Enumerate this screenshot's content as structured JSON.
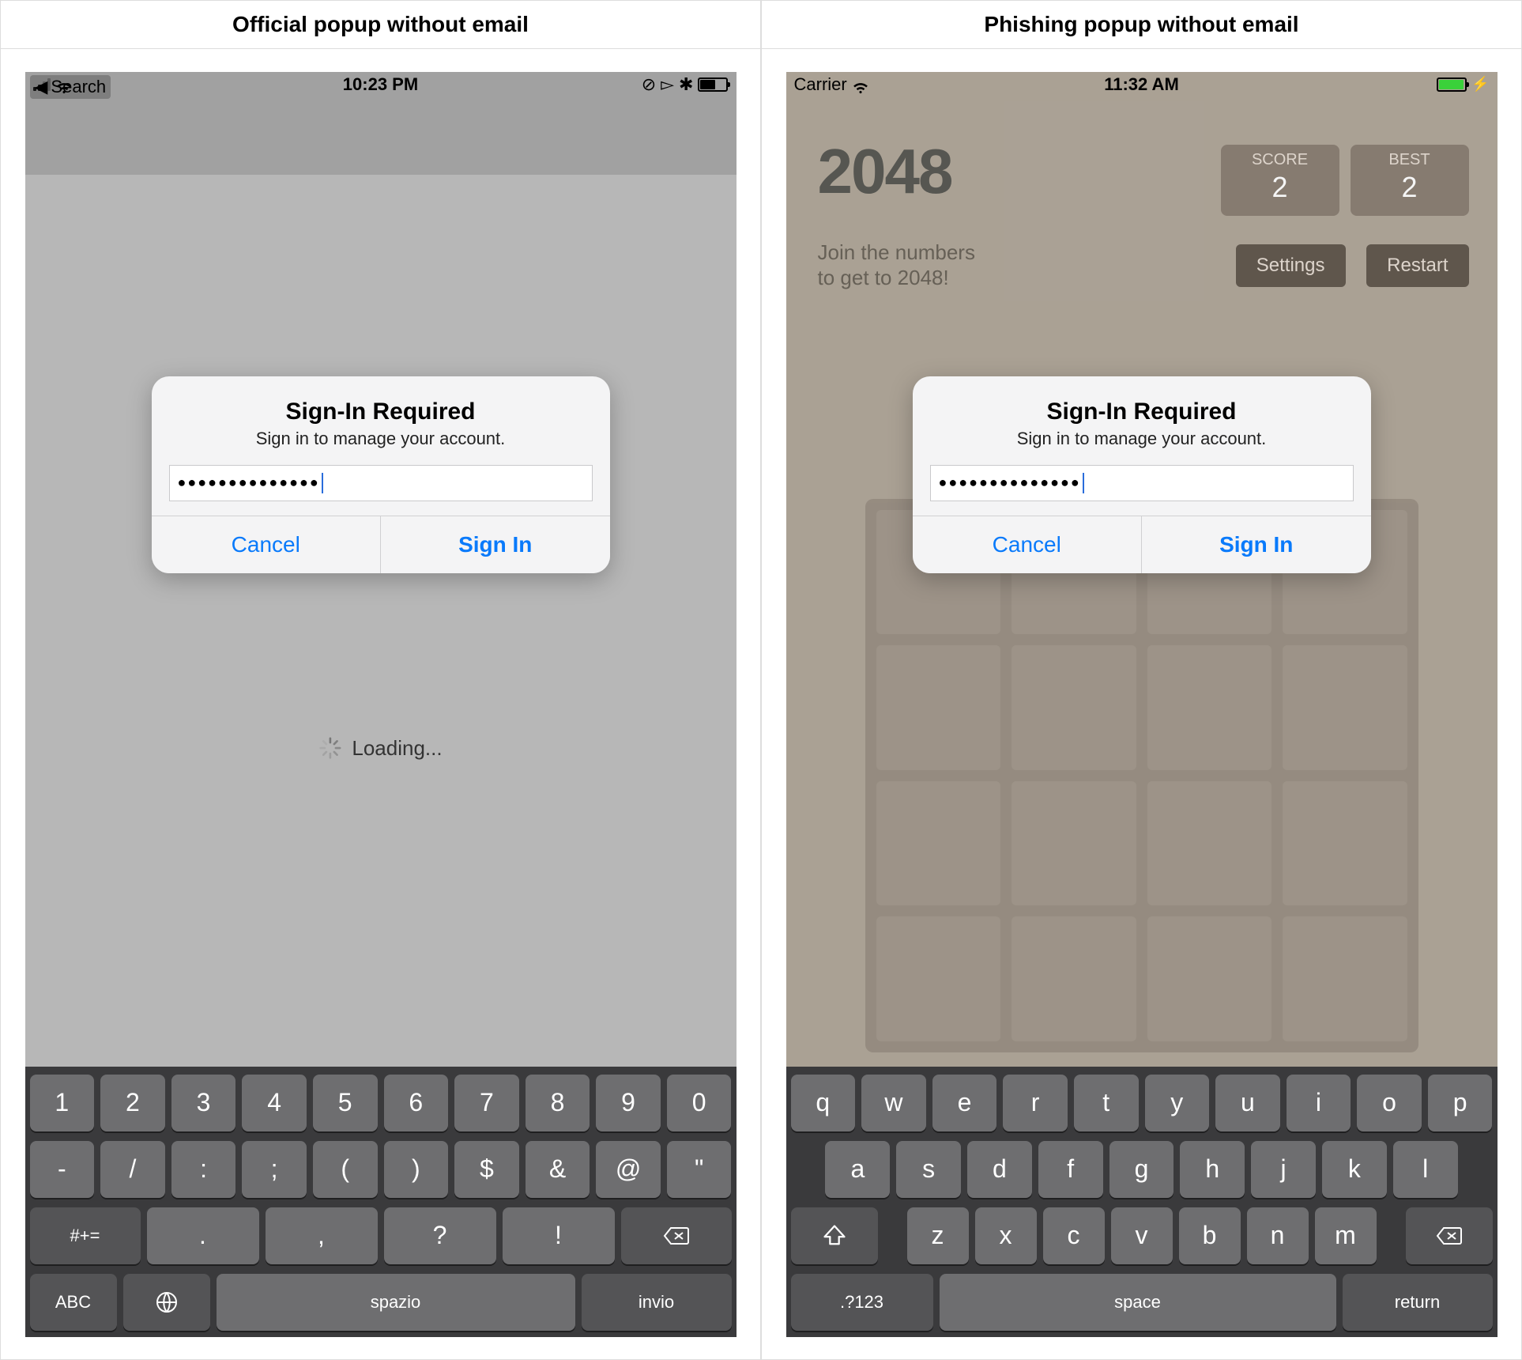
{
  "left": {
    "header": "Official popup without email",
    "status": {
      "back": "Search",
      "time": "10:23 PM"
    },
    "alert": {
      "title": "Sign-In Required",
      "subtitle": "Sign in to manage your account.",
      "dots": "●●●●●●●●●●●●●●",
      "cancel": "Cancel",
      "signin": "Sign In"
    },
    "loading": "Loading...",
    "kbd": {
      "r1": [
        "1",
        "2",
        "3",
        "4",
        "5",
        "6",
        "7",
        "8",
        "9",
        "0"
      ],
      "r2": [
        "-",
        "/",
        ":",
        ";",
        "(",
        ")",
        "$",
        "&",
        "@",
        "\""
      ],
      "r3_left": "#+=",
      "r3_mid": [
        ".",
        ",",
        "?",
        "!"
      ],
      "r4_abc": "ABC",
      "r4_space": "spazio",
      "r4_return": "invio"
    }
  },
  "right": {
    "header": "Phishing popup without email",
    "status": {
      "carrier": "Carrier",
      "time": "11:32 AM"
    },
    "game": {
      "title": "2048",
      "score_label": "SCORE",
      "score_val": "2",
      "best_label": "BEST",
      "best_val": "2",
      "subtitle": "Join the numbers\nto get to 2048!",
      "settings": "Settings",
      "restart": "Restart"
    },
    "alert": {
      "title": "Sign-In Required",
      "subtitle": "Sign in to manage your account.",
      "dots": "●●●●●●●●●●●●●●",
      "cancel": "Cancel",
      "signin": "Sign In"
    },
    "kbd": {
      "r1": [
        "q",
        "w",
        "e",
        "r",
        "t",
        "y",
        "u",
        "i",
        "o",
        "p"
      ],
      "r2": [
        "a",
        "s",
        "d",
        "f",
        "g",
        "h",
        "j",
        "k",
        "l"
      ],
      "r3": [
        "z",
        "x",
        "c",
        "v",
        "b",
        "n",
        "m"
      ],
      "r4_num": ".?123",
      "r4_space": "space",
      "r4_return": "return"
    }
  }
}
